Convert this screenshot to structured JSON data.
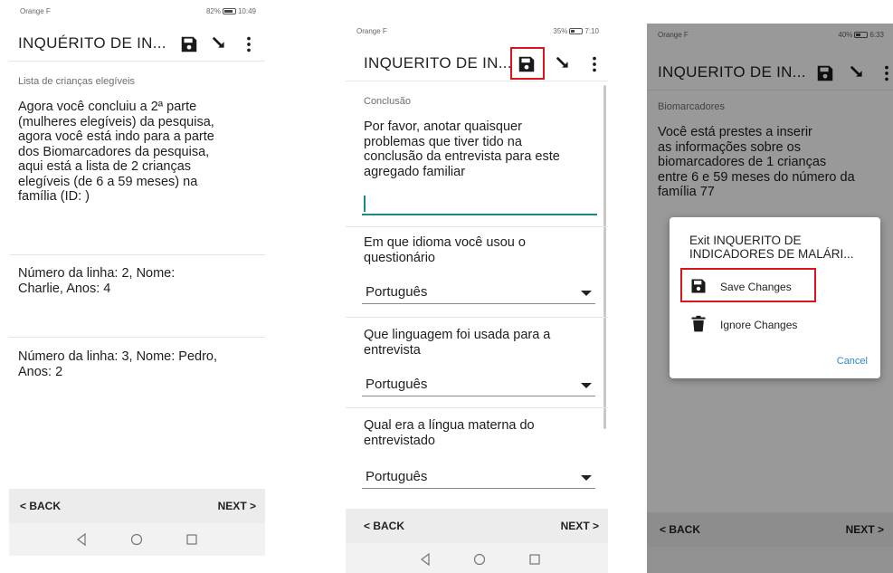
{
  "status_bars": {
    "p1": {
      "carrier": "Orange F",
      "battery": "82%",
      "time": "10:49",
      "battery_level": 0.82
    },
    "p2": {
      "carrier": "Orange F",
      "battery": "35%",
      "time": "7:10",
      "battery_level": 0.35
    },
    "p3": {
      "carrier": "Orange F",
      "battery": "40%",
      "time": "6:33",
      "battery_level": 0.4
    }
  },
  "app": {
    "title": "INQUÉRITO DE IN...",
    "title_plain": "INQUERITO DE IN..."
  },
  "icons": {
    "save": "save-icon",
    "sync": "sync-arrow-icon",
    "more": "more-vertical-icon",
    "trash": "trash-icon"
  },
  "colors": {
    "highlight": "#d8141c",
    "accent": "#1b8a86",
    "link": "#2e86c6"
  },
  "screen1": {
    "section": "Lista de crianças elegíveis",
    "intro_lines": [
      "Agora você concluiu a 2ª parte",
      "(mulheres elegíveis) da pesquisa,",
      "agora você está indo para a parte",
      "dos Biomarcadores da pesquisa,",
      "aqui está a lista de 2 crianças",
      "elegíveis (de 6 a 59 meses) na",
      "família (ID: )"
    ],
    "children": [
      {
        "lines": [
          "Número da linha: 2, Nome:",
          "Charlie, Anos: 4"
        ]
      },
      {
        "lines": [
          "Número da linha: 3, Nome: Pedro,",
          "Anos: 2"
        ]
      }
    ]
  },
  "screen2": {
    "section": "Conclusão",
    "prompt_lines": [
      "Por favor, anotar quaisquer",
      "problemas que tiver tido na",
      "conclusão da entrevista para este",
      "agregado familiar"
    ],
    "questions": [
      {
        "lines": [
          "Em que idioma você usou o",
          "questionário"
        ],
        "value": "Português"
      },
      {
        "lines": [
          "Que linguagem foi usada para a",
          "entrevista"
        ],
        "value": "Português"
      },
      {
        "lines": [
          "Qual era a língua materna do",
          "entrevistado"
        ],
        "value": "Português"
      }
    ]
  },
  "screen3": {
    "section": "Biomarcadores",
    "text_lines": [
      "Você está prestes a inserir",
      "as informações sobre os",
      "biomarcadores de 1 crianças",
      "entre 6 e 59 meses do número da",
      "família 77"
    ],
    "dialog": {
      "title_lines": [
        "Exit INQUERITO DE",
        "INDICADORES DE MALÁRI..."
      ],
      "save": "Save Changes",
      "ignore": "Ignore Changes",
      "cancel": "Cancel"
    }
  },
  "footer": {
    "back": "< BACK",
    "next": "NEXT >"
  }
}
